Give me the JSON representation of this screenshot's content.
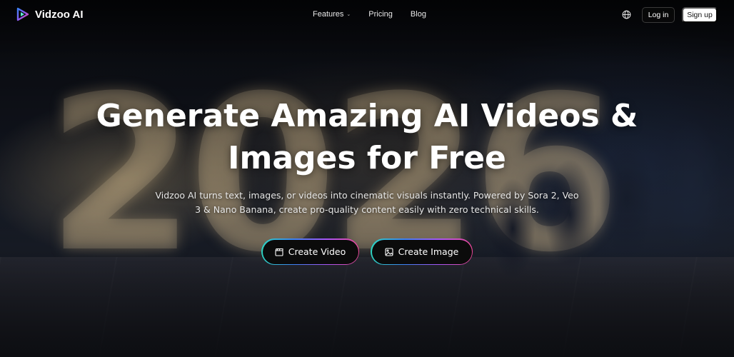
{
  "brand": {
    "name": "Vidzoo AI",
    "logo_icon": "play-logo-icon"
  },
  "nav": {
    "links": [
      {
        "label": "Features",
        "has_dropdown": true
      },
      {
        "label": "Pricing"
      },
      {
        "label": "Blog"
      }
    ],
    "language_icon": "globe-icon",
    "login_label": "Log in",
    "signup_label": "Sign up"
  },
  "hero": {
    "title": "Generate Amazing AI Videos & Images for Free",
    "subtitle": "Vidzoo AI turns text, images, or videos into cinematic visuals instantly. Powered by Sora 2, Veo 3 & Nano Banana, create pro-quality content easily with zero technical skills.",
    "background_text": "2026",
    "buttons": [
      {
        "label": "Create Video",
        "icon": "clapperboard-icon"
      },
      {
        "label": "Create Image",
        "icon": "image-icon"
      }
    ]
  },
  "colors": {
    "accent_gradient": [
      "#2dd4bf",
      "#3b82f6",
      "#a855f7",
      "#ec4899"
    ],
    "signup_bg": "#ffffff",
    "button_bg": "#0b0b0b"
  }
}
